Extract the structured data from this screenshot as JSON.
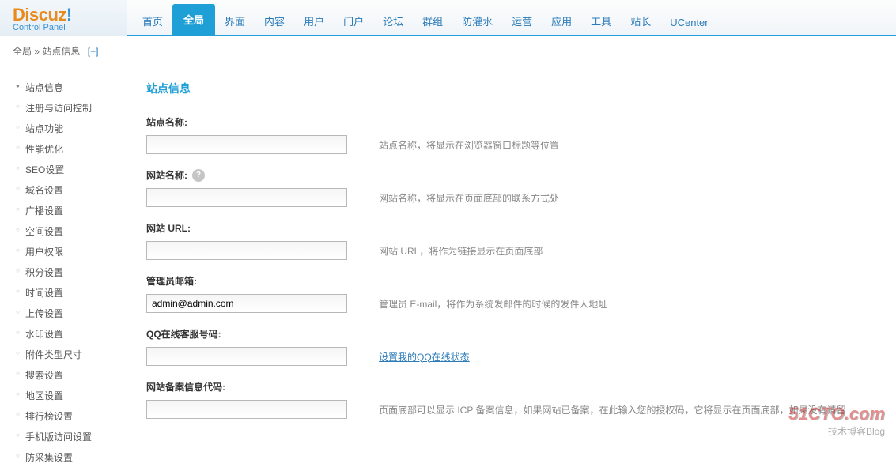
{
  "logo": {
    "text": "Discuz",
    "punct": "!",
    "subtitle": "Control Panel"
  },
  "nav": {
    "items": [
      {
        "label": "首页"
      },
      {
        "label": "全局",
        "active": true
      },
      {
        "label": "界面"
      },
      {
        "label": "内容"
      },
      {
        "label": "用户"
      },
      {
        "label": "门户"
      },
      {
        "label": "论坛"
      },
      {
        "label": "群组"
      },
      {
        "label": "防灌水"
      },
      {
        "label": "运营"
      },
      {
        "label": "应用"
      },
      {
        "label": "工具"
      },
      {
        "label": "站长"
      },
      {
        "label": "UCenter"
      }
    ]
  },
  "breadcrumb": {
    "root": "全局",
    "sep": "»",
    "current": "站点信息",
    "expand": "[+]"
  },
  "sidebar": {
    "items": [
      {
        "label": "站点信息",
        "active": true
      },
      {
        "label": "注册与访问控制"
      },
      {
        "label": "站点功能"
      },
      {
        "label": "性能优化"
      },
      {
        "label": "SEO设置"
      },
      {
        "label": "域名设置"
      },
      {
        "label": "广播设置"
      },
      {
        "label": "空间设置"
      },
      {
        "label": "用户权限"
      },
      {
        "label": "积分设置"
      },
      {
        "label": "时间设置"
      },
      {
        "label": "上传设置"
      },
      {
        "label": "水印设置"
      },
      {
        "label": "附件类型尺寸"
      },
      {
        "label": "搜索设置"
      },
      {
        "label": "地区设置"
      },
      {
        "label": "排行榜设置"
      },
      {
        "label": "手机版访问设置"
      },
      {
        "label": "防采集设置"
      }
    ]
  },
  "section": {
    "title": "站点信息"
  },
  "form": {
    "sitename": {
      "label": "站点名称:",
      "value": "",
      "desc": "站点名称，将显示在浏览器窗口标题等位置"
    },
    "webname": {
      "label": "网站名称:",
      "has_help": true,
      "value": "",
      "desc": "网站名称，将显示在页面底部的联系方式处"
    },
    "siteurl": {
      "label": "网站 URL:",
      "value": "",
      "desc": "网站 URL，将作为链接显示在页面底部"
    },
    "adminemail": {
      "label": "管理员邮箱:",
      "value": "admin@admin.com",
      "desc": "管理员 E-mail，将作为系统发邮件的时候的发件人地址"
    },
    "qq": {
      "label": "QQ在线客服号码:",
      "value": "",
      "link": "设置我的QQ在线状态"
    },
    "icp": {
      "label": "网站备案信息代码:",
      "value": "",
      "desc": "页面底部可以显示 ICP 备案信息，如果网站已备案，在此输入您的授权码，它将显示在页面底部，如果没有请留"
    }
  },
  "watermark": {
    "line1": "51CTO.com",
    "line2": "技术博客Blog"
  }
}
